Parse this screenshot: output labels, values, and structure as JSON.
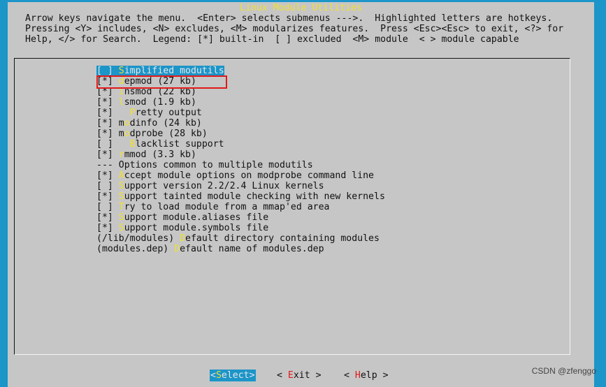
{
  "title": "Linux Module Utilities",
  "help": {
    "line1": "Arrow keys navigate the menu.  <Enter> selects submenus --->.  Highlighted letters are hotkeys.",
    "line2": "Pressing <Y> includes, <N> excludes, <M> modularizes features.  Press <Esc><Esc> to exit, <?> for",
    "line3": "Help, </> for Search.  Legend: [*] built-in  [ ] excluded  <M> module  < > module capable"
  },
  "menu": {
    "items": [
      {
        "prefix": "[ ] ",
        "hk": "S",
        "rest": "implified modutils",
        "selected": true
      },
      {
        "prefix": "[*] ",
        "hk": "d",
        "rest": "epmod (27 kb)"
      },
      {
        "prefix": "[*] ",
        "hk": "i",
        "rest": "nsmod (22 kb)"
      },
      {
        "prefix": "[*] ",
        "hk": "l",
        "rest": "smod (1.9 kb)"
      },
      {
        "prefix": "[*]   ",
        "hk": "P",
        "rest": "retty output"
      },
      {
        "prefix": "[*] m",
        "hk": "o",
        "rest": "dinfo (24 kb)"
      },
      {
        "prefix": "[*] m",
        "hk": "o",
        "rest": "dprobe (28 kb)"
      },
      {
        "prefix": "[ ]   ",
        "hk": "B",
        "rest": "lacklist support"
      },
      {
        "prefix": "[*] ",
        "hk": "r",
        "rest": "mmod (3.3 kb)"
      },
      {
        "prefix": "--- Options common to multiple modutils",
        "hk": "",
        "rest": ""
      },
      {
        "prefix": "[*] ",
        "hk": "A",
        "rest": "ccept module options on modprobe command line"
      },
      {
        "prefix": "[ ] ",
        "hk": "S",
        "rest": "upport version 2.2/2.4 Linux kernels"
      },
      {
        "prefix": "[*] ",
        "hk": "S",
        "rest": "upport tainted module checking with new kernels"
      },
      {
        "prefix": "[ ] ",
        "hk": "T",
        "rest": "ry to load module from a mmap'ed area"
      },
      {
        "prefix": "[*] ",
        "hk": "S",
        "rest": "upport module.aliases file"
      },
      {
        "prefix": "[*] ",
        "hk": "S",
        "rest": "upport module.symbols file"
      },
      {
        "prefix": "(/lib/modules) ",
        "hk": "D",
        "rest": "efault directory containing modules"
      },
      {
        "prefix": "(modules.dep) ",
        "hk": "D",
        "rest": "efault name of modules.dep"
      }
    ]
  },
  "buttons": {
    "select": {
      "pre": "<",
      "hk": "S",
      "rest": "elect>"
    },
    "exit": {
      "pre": "< ",
      "hk": "E",
      "rest": "xit >"
    },
    "help": {
      "pre": "< ",
      "hk": "H",
      "rest": "elp >"
    }
  },
  "watermark": "CSDN @zfenggo",
  "colors": {
    "background": "#1c95c9",
    "dialog": "#c6c6c6",
    "hotkey": "#f0df32",
    "annotation_box": "#e11a1a"
  }
}
